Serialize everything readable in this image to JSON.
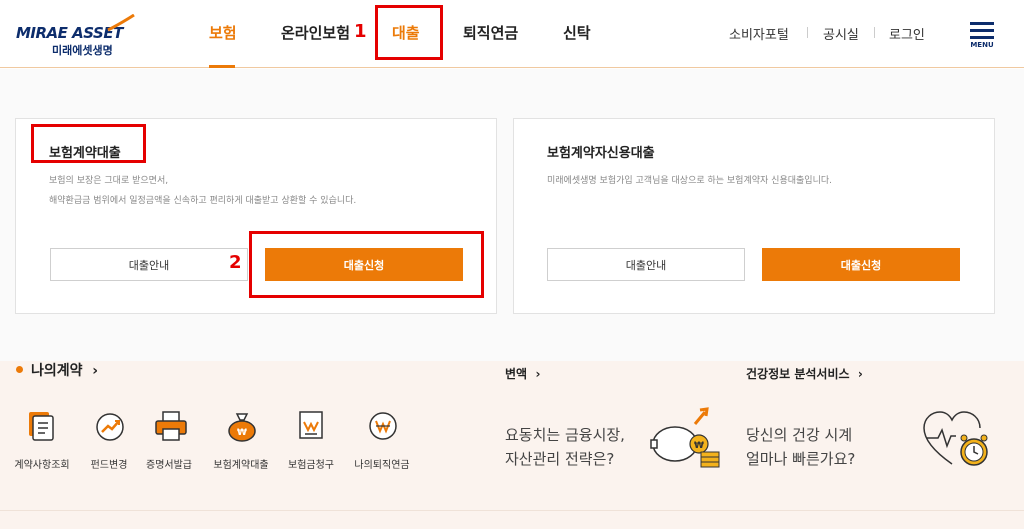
{
  "header": {
    "logo_en": "MIRAE ASSET",
    "logo_ko": "미래에셋생명",
    "nav": [
      {
        "label": "보험",
        "active": true
      },
      {
        "label": "온라인보험",
        "active": false
      },
      {
        "label": "대출",
        "active": false
      },
      {
        "label": "퇴직연금",
        "active": false
      },
      {
        "label": "신탁",
        "active": false
      }
    ],
    "utils": [
      "소비자포털",
      "공시실",
      "로그인"
    ],
    "menu_label": "MENU"
  },
  "annotations": [
    "1",
    "2"
  ],
  "cards": [
    {
      "title": "보험계약대출",
      "desc_lines": [
        "보험의 보장은 그대로 받으면서,",
        "해약환급금 범위에서 일정금액을 신속하고 편리하게 대출받고 상환할 수 있습니다."
      ],
      "guide_label": "대출안내",
      "apply_label": "대출신청"
    },
    {
      "title": "보험계약자신용대출",
      "desc_lines": [
        "미래에셋생명 보험가입 고객님을 대상으로 하는 보험계약자 신용대출입니다."
      ],
      "guide_label": "대출안내",
      "apply_label": "대출신청"
    }
  ],
  "my_contract": {
    "title": "나의계약",
    "items": [
      "계약사항조회",
      "펀드변경",
      "증명서발급",
      "보험계약대출",
      "보험금청구",
      "나의퇴직연금"
    ]
  },
  "variable": {
    "title": "변액",
    "promo_lines": [
      "요동치는 금융시장,",
      "자산관리 전략은?"
    ]
  },
  "health": {
    "title": "건강정보 분석서비스",
    "promo_lines": [
      "당신의 건강 시계",
      "얼마나 빠른가요?"
    ]
  },
  "colors": {
    "accent": "#ec7a08",
    "brand_navy": "#0d2d6c",
    "annotation_red": "#e50000"
  }
}
